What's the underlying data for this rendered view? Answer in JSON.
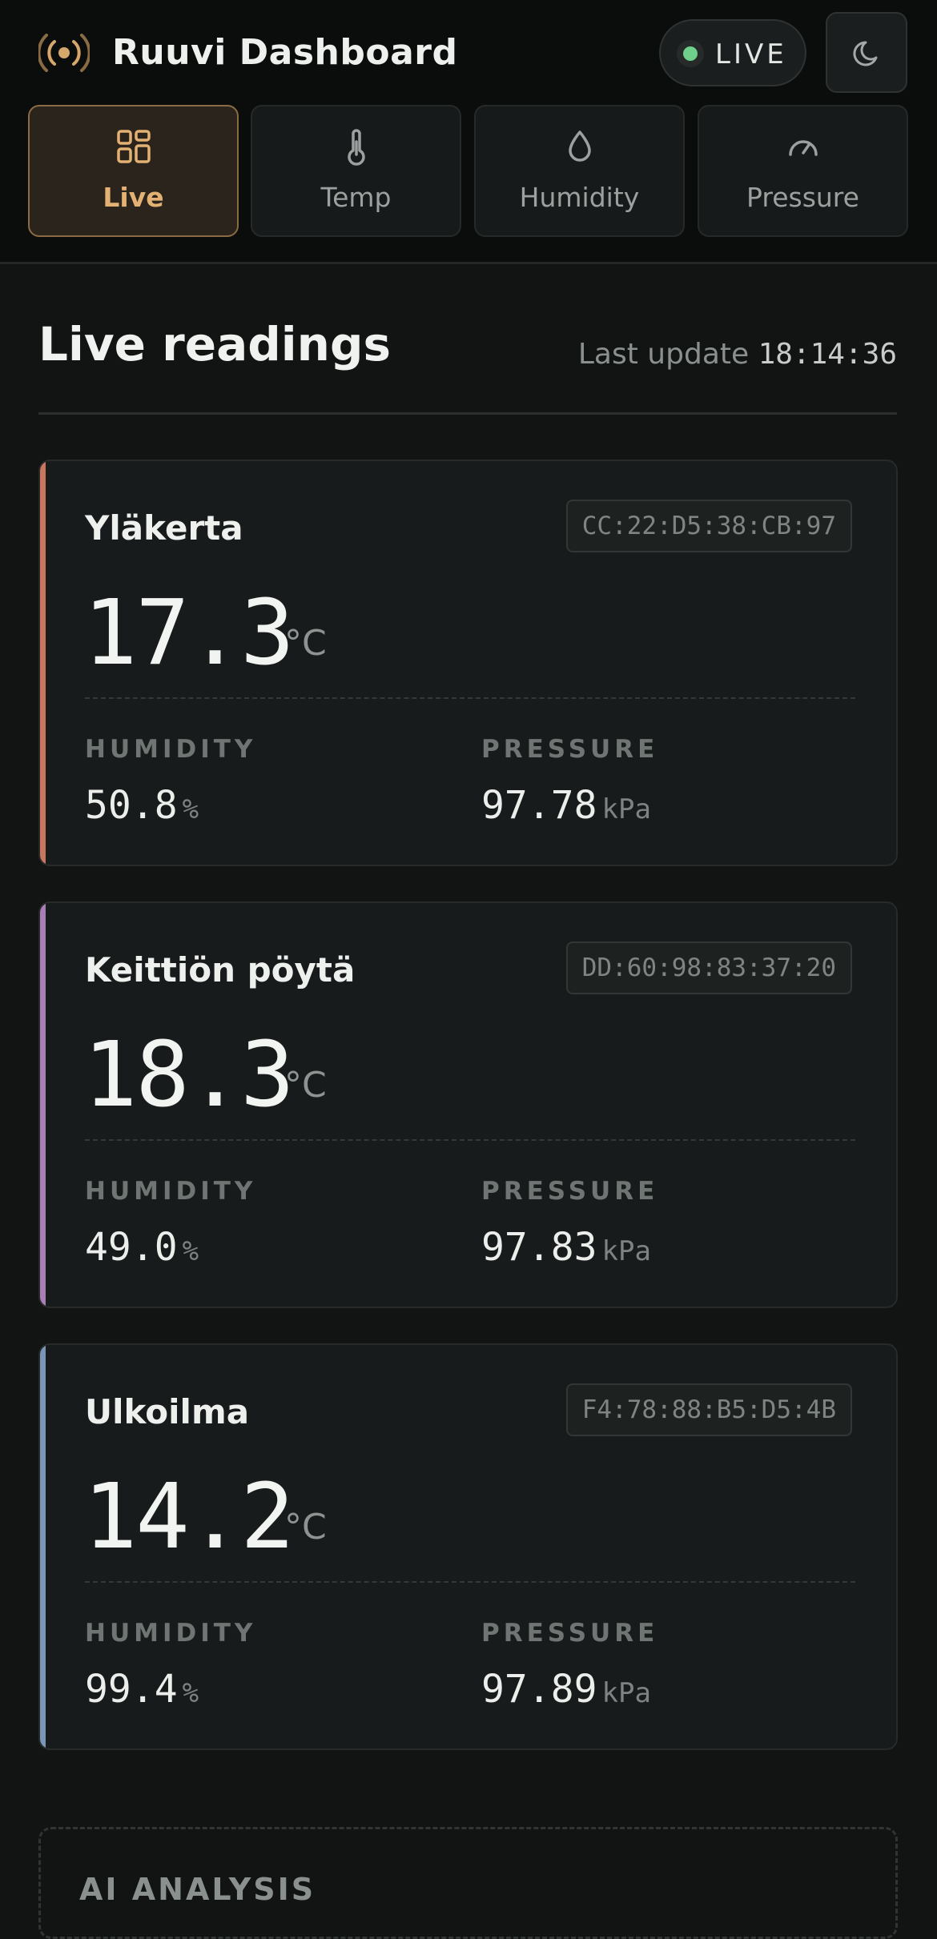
{
  "header": {
    "title": "Ruuvi Dashboard",
    "live_label": "LIVE",
    "brand_icon": "broadcast-icon",
    "theme_icon": "moon-icon"
  },
  "tabs": [
    {
      "label": "Live",
      "icon": "grid-icon",
      "active": true
    },
    {
      "label": "Temp",
      "icon": "thermometer-icon",
      "active": false
    },
    {
      "label": "Humidity",
      "icon": "droplet-icon",
      "active": false
    },
    {
      "label": "Pressure",
      "icon": "gauge-icon",
      "active": false
    }
  ],
  "main": {
    "title": "Live readings",
    "last_update_label": "Last update",
    "last_update_time": "18:14:36"
  },
  "sensors": [
    {
      "name": "Yläkerta",
      "mac": "CC:22:D5:38:CB:97",
      "temperature": "17.3",
      "temp_unit": "°C",
      "humidity_label": "HUMIDITY",
      "humidity": "50.8",
      "humidity_unit": "%",
      "pressure_label": "PRESSURE",
      "pressure": "97.78",
      "pressure_unit": "kPa",
      "accent": "#c9765f"
    },
    {
      "name": "Keittiön pöytä",
      "mac": "DD:60:98:83:37:20",
      "temperature": "18.3",
      "temp_unit": "°C",
      "humidity_label": "HUMIDITY",
      "humidity": "49.0",
      "humidity_unit": "%",
      "pressure_label": "PRESSURE",
      "pressure": "97.83",
      "pressure_unit": "kPa",
      "accent": "#a77fb4"
    },
    {
      "name": "Ulkoilma",
      "mac": "F4:78:88:B5:D5:4B",
      "temperature": "14.2",
      "temp_unit": "°C",
      "humidity_label": "HUMIDITY",
      "humidity": "99.4",
      "humidity_unit": "%",
      "pressure_label": "PRESSURE",
      "pressure": "97.89",
      "pressure_unit": "kPa",
      "accent": "#7b95b8"
    }
  ],
  "ai": {
    "label": "AI ANALYSIS"
  },
  "colors": {
    "accent": "#e2b173",
    "live_dot": "#6fd08c",
    "background": "#121414"
  }
}
